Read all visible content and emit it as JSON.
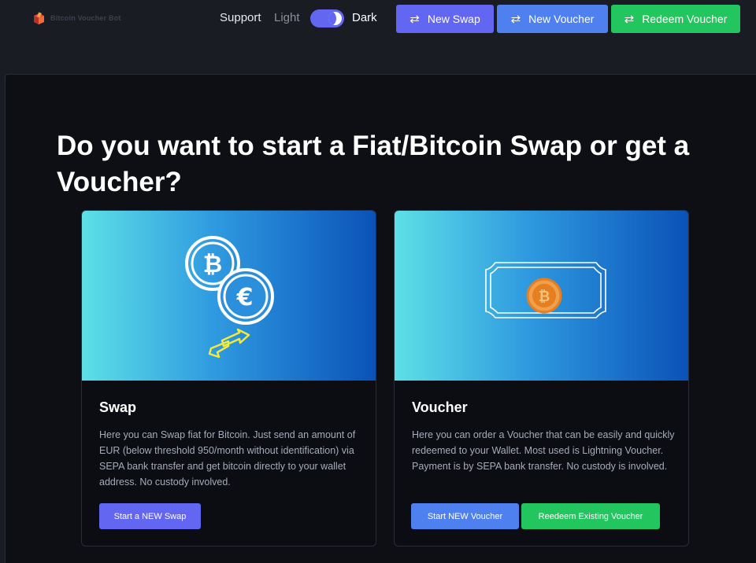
{
  "header": {
    "logo_text": "Bitcoin Voucher Bot",
    "support_label": "Support",
    "theme_light_label": "Light",
    "theme_dark_label": "Dark",
    "theme_mode": "dark",
    "buttons": [
      {
        "label": "New Swap",
        "icon": "swap-arrows-icon"
      },
      {
        "label": "New Voucher",
        "icon": "swap-arrows-icon"
      },
      {
        "label": "Redeem Voucher",
        "icon": "swap-arrows-icon"
      }
    ]
  },
  "main": {
    "title": "Do you want to start a Fiat/Bitcoin Swap or get a Voucher?",
    "cards": [
      {
        "title": "Swap",
        "description": "Here you can Swap fiat for Bitcoin. Just send an amount of EUR (below threshold 950/month without identification) via SEPA bank transfer and get bitcoin directly to your wallet address. No custody involved.",
        "banner_icons": [
          "bitcoin-coin-icon",
          "euro-coin-icon",
          "exchange-arrows-icon"
        ],
        "buttons": [
          "Start a NEW Swap"
        ]
      },
      {
        "title": "Voucher",
        "description": "Here you can order a Voucher that can be easily and quickly redeemed to your Wallet. Most used is Lightning Voucher. Payment is by SEPA bank transfer. No custody is involved.",
        "banner_icons": [
          "voucher-ticket-icon"
        ],
        "buttons": [
          "Start NEW Voucher",
          "Reedeem Existing Voucher"
        ]
      }
    ]
  },
  "colors": {
    "background": "#1a1c23",
    "panel": "#0d0f15",
    "indigo": "#6366f1",
    "blue": "#4f80f0",
    "green": "#22c55e",
    "banner_gradient": [
      "#5de0e6",
      "#2f9ae0",
      "#0a52b8"
    ]
  }
}
